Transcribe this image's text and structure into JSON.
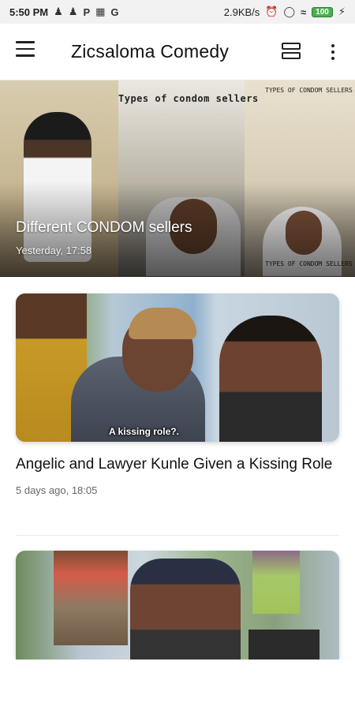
{
  "status_bar": {
    "time": "5:50 PM",
    "icons": [
      "person-icon",
      "person-icon",
      "p-icon",
      "trash-icon",
      "g-icon"
    ],
    "p_letter": "P",
    "g_letter": "G",
    "network_speed": "2.9KB/s",
    "battery": "100"
  },
  "app_bar": {
    "title": "Zicsaloma Comedy"
  },
  "hero": {
    "title": "Different CONDOM sellers",
    "time": "Yesterday, 17:58",
    "thumbnail_text": "Types of condom sellers",
    "thumbnail_small_text": "TYPES OF CONDOM SELLERS"
  },
  "posts": [
    {
      "title": "Angelic and Lawyer Kunle Given a Kissing Role",
      "time": "5 days ago, 18:05",
      "thumbnail_subtitle": "A kissing role?."
    },
    {
      "title": "",
      "time": ""
    }
  ],
  "colors": {
    "accent": "#4caf50",
    "text": "#111111",
    "muted": "#666666"
  }
}
